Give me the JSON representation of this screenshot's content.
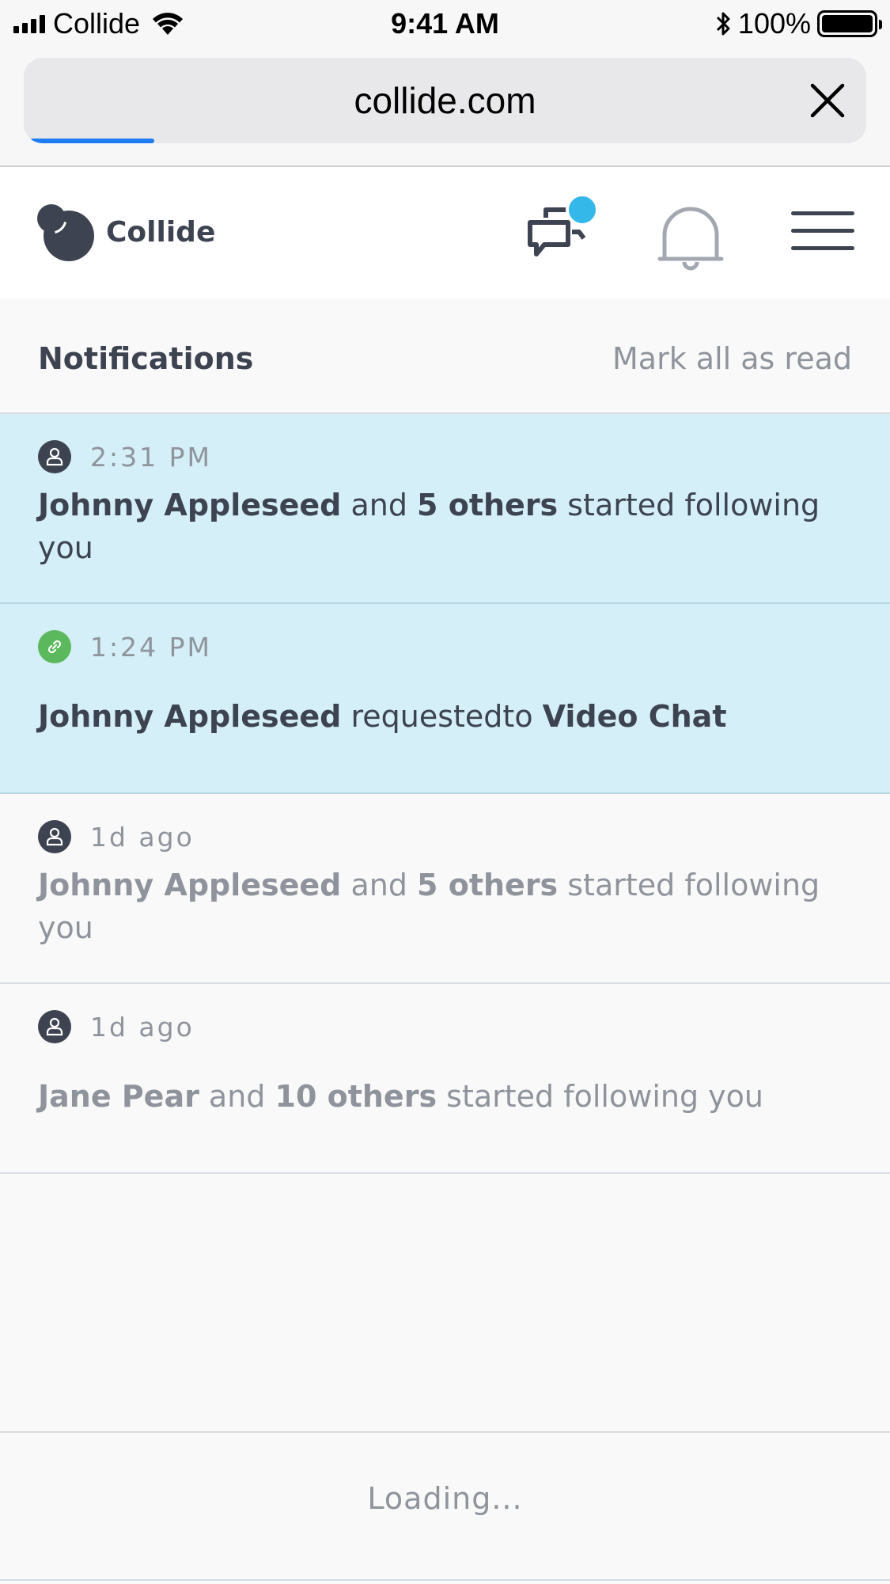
{
  "status_bar": {
    "carrier": "Collide",
    "time": "9:41 AM",
    "battery": "100%"
  },
  "browser": {
    "url": "collide.com",
    "load_progress": 0.15
  },
  "site": {
    "brand": "Collide",
    "chat_has_unread": true
  },
  "notifications": {
    "title": "Notifications",
    "mark_all": "Mark all as read",
    "items": [
      {
        "time": "2:31 PM",
        "icon": "person-icon",
        "unread": true,
        "actor": "Johnny Appleseed",
        "connector": " and ",
        "target": "5 others",
        "rest": " started following you"
      },
      {
        "time": "1:24 PM",
        "icon": "link-icon",
        "unread": true,
        "actor": "Johnny Appleseed",
        "connector": " requestedto ",
        "target": "Video Chat",
        "rest": ""
      },
      {
        "time": "1d ago",
        "icon": "person-icon",
        "unread": false,
        "actor": "Johnny Appleseed",
        "connector": " and ",
        "target": "5 others",
        "rest": " started following you"
      },
      {
        "time": "1d ago",
        "icon": "person-icon",
        "unread": false,
        "actor": "Jane Pear",
        "connector": " and ",
        "target": "10 others",
        "rest": " started following you"
      }
    ]
  },
  "footer": {
    "loading": "Loading..."
  },
  "colors": {
    "unread_bg": "#d4eff7",
    "accent_blue": "#1e7cf2",
    "badge": "#34b8ea",
    "link_green": "#5cb85c",
    "text_dark": "#3d4350",
    "text_muted": "#8f949c"
  }
}
